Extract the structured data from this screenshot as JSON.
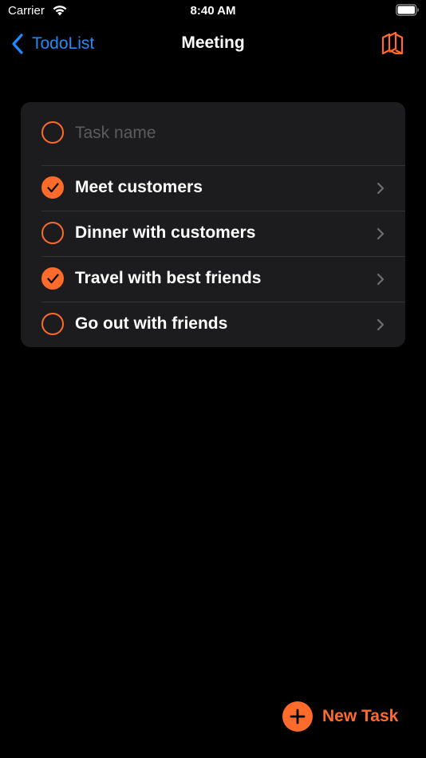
{
  "status_bar": {
    "carrier": "Carrier",
    "time": "8:40 AM"
  },
  "nav": {
    "back_label": "TodoList",
    "title": "Meeting",
    "action_icon": "stacked-cards-icon"
  },
  "task_input": {
    "placeholder": "Task name",
    "value": ""
  },
  "tasks": [
    {
      "label": "Meet customers",
      "completed": true
    },
    {
      "label": "Dinner with customers",
      "completed": false
    },
    {
      "label": "Travel with best friends",
      "completed": true
    },
    {
      "label": "Go out with friends",
      "completed": false
    }
  ],
  "footer": {
    "new_task_label": "New Task"
  },
  "colors": {
    "accent": "#ff6b2b",
    "link": "#1e8cff",
    "background": "#000000",
    "card": "#1c1c1e"
  }
}
